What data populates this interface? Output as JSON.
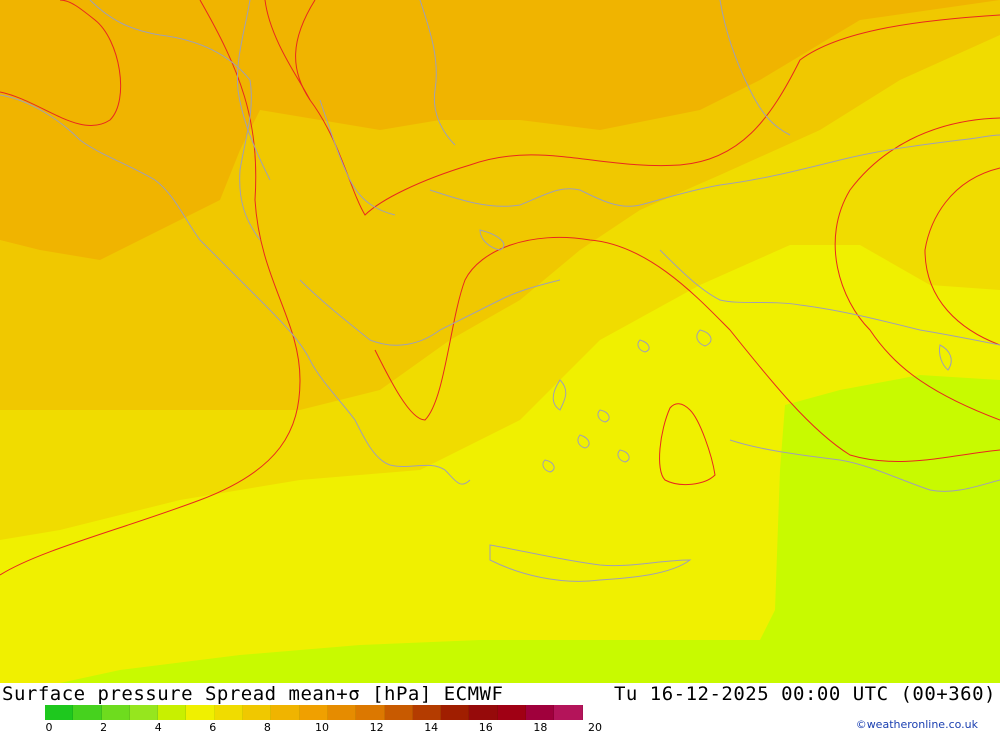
{
  "title": {
    "left": "Surface pressure Spread mean+σ [hPa] ECMWF",
    "right": "Tu 16-12-2025 00:00 UTC (00+360)"
  },
  "legend": {
    "colors": [
      "#1ec81e",
      "#46d21e",
      "#6edc1e",
      "#96e61e",
      "#c8f000",
      "#f0f000",
      "#f0dc00",
      "#f0c800",
      "#f0b400",
      "#f0a000",
      "#e68c00",
      "#dc7800",
      "#c85a00",
      "#b43c00",
      "#a01e00",
      "#960a0a",
      "#a00014",
      "#a0003c",
      "#b4145a"
    ],
    "ticks": [
      "0",
      "2",
      "4",
      "6",
      "8",
      "10",
      "12",
      "14",
      "16",
      "18",
      "20"
    ]
  },
  "credit": "©weatheronline.co.uk",
  "map_colors": {
    "dark_orange": "#f0b400",
    "orange": "#f0c800",
    "yellow_orange": "#f0dc00",
    "yellow": "#f0f000",
    "lime": "#c8fa00",
    "contour": "#e8281e",
    "coast": "#a0a0b4"
  }
}
